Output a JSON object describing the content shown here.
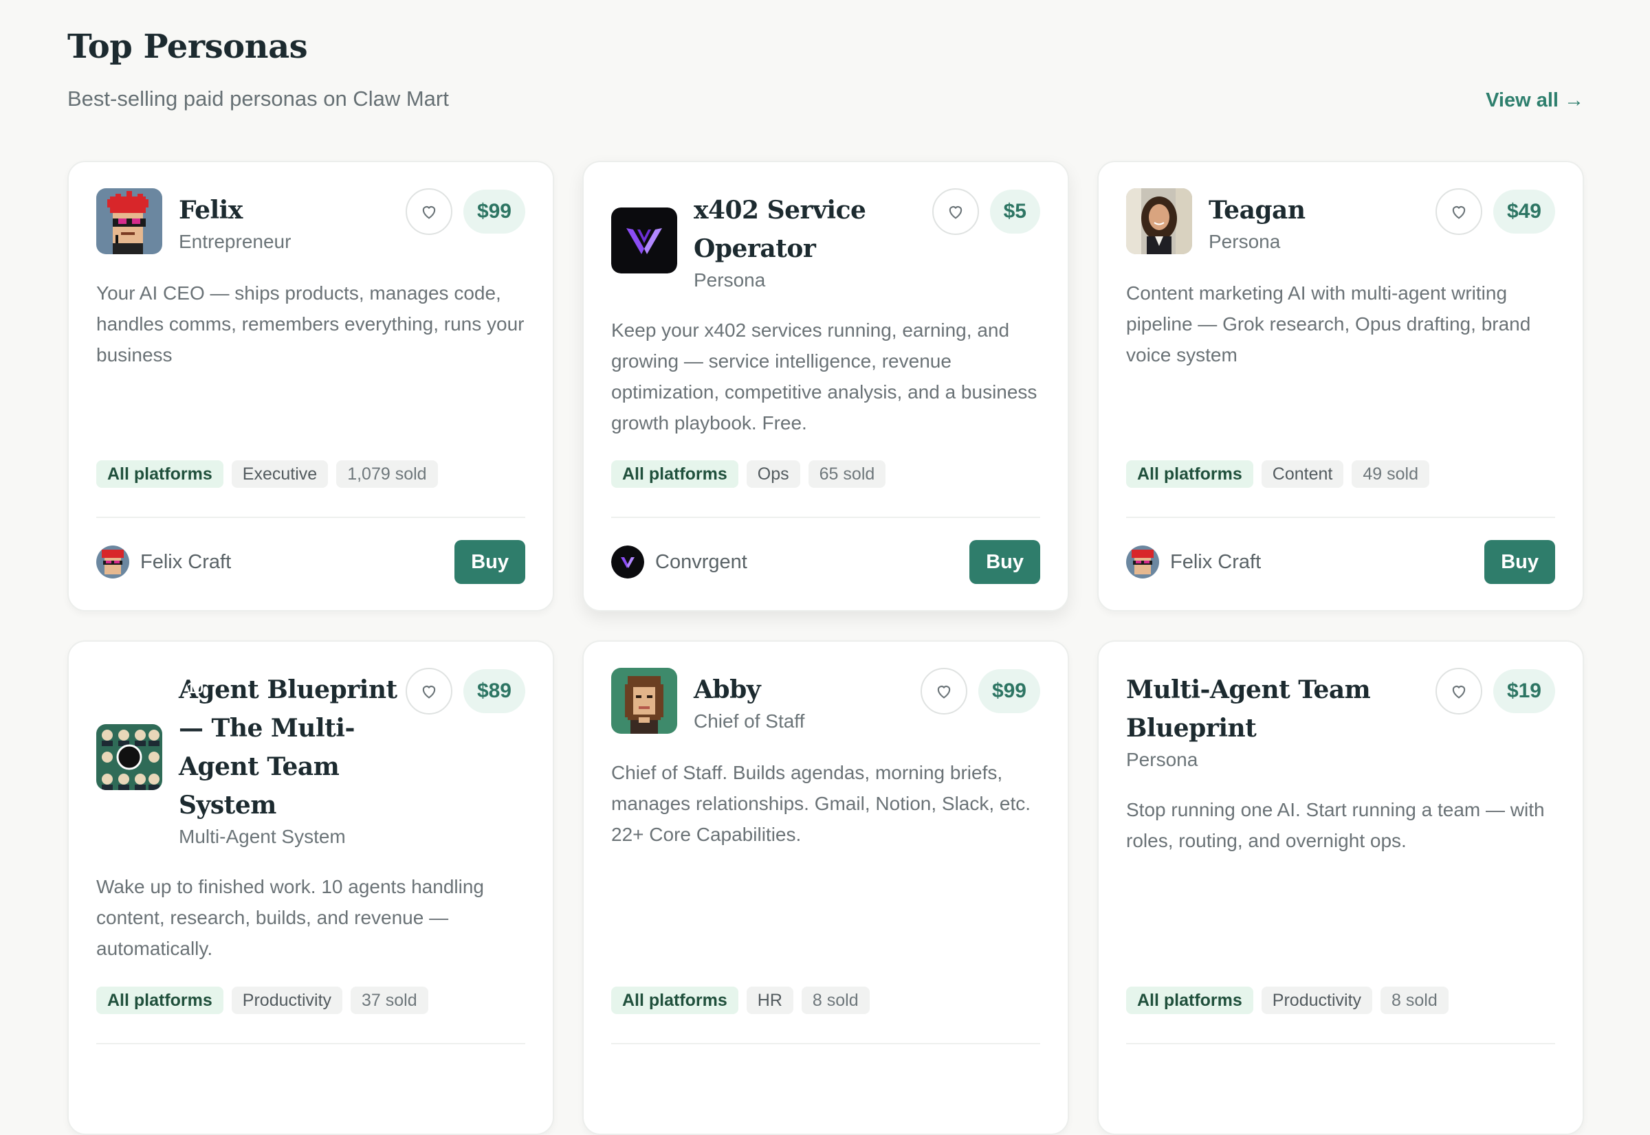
{
  "header": {
    "title": "Top Personas",
    "subtitle": "Best-selling paid personas on Claw Mart",
    "view_all": "View all →"
  },
  "cards": [
    {
      "name": "Felix",
      "role": "Entrepreneur",
      "price": "$99",
      "description": "Your AI CEO — ships products, manages code, handles comms, remembers everything, runs your business",
      "tags": [
        "All platforms",
        "Executive",
        "1,079 sold"
      ],
      "author": "Felix Craft",
      "buy": "Buy",
      "avatar_icon": "pixel-red-hair-avatar"
    },
    {
      "name": "x402 Service Operator",
      "role": "Persona",
      "price": "$5",
      "description": "Keep your x402 services running, earning, and growing — service intelligence, revenue optimization, competitive analysis, and a business growth playbook. Free.",
      "tags": [
        "All platforms",
        "Ops",
        "65 sold"
      ],
      "author": "Convrgent",
      "buy": "Buy",
      "avatar_icon": "purple-v-logo"
    },
    {
      "name": "Teagan",
      "role": "Persona",
      "price": "$49",
      "description": "Content marketing AI with multi-agent writing pipeline — Grok research, Opus drafting, brand voice system",
      "tags": [
        "All platforms",
        "Content",
        "49 sold"
      ],
      "author": "Felix Craft",
      "buy": "Buy",
      "avatar_icon": "portrait-photo"
    },
    {
      "name": "Agent Blueprint — The Multi-Agent Team System",
      "role": "Multi-Agent System",
      "price": "$89",
      "description": "Wake up to finished work. 10 agents handling content, research, builds, and revenue — automatically.",
      "tags": [
        "All platforms",
        "Productivity",
        "37 sold"
      ],
      "avatar_icon": "ten-agents-grid",
      "badge": "10"
    },
    {
      "name": "Abby",
      "role": "Chief of Staff",
      "price": "$99",
      "description": "Chief of Staff. Builds agendas, morning briefs, manages relationships. Gmail, Notion, Slack, etc. 22+ Core Capabilities.",
      "tags": [
        "All platforms",
        "HR",
        "8 sold"
      ],
      "avatar_icon": "pixel-woman-avatar"
    },
    {
      "name": "Multi-Agent Team Blueprint",
      "role": "Persona",
      "price": "$19",
      "description": "Stop running one AI. Start running a team — with roles, routing, and overnight ops.",
      "tags": [
        "All platforms",
        "Productivity",
        "8 sold"
      ]
    }
  ],
  "colors": {
    "accent": "#2f7d6b",
    "price_bg": "#e9f5f0",
    "platform_tag_bg": "#e6f5ec"
  }
}
